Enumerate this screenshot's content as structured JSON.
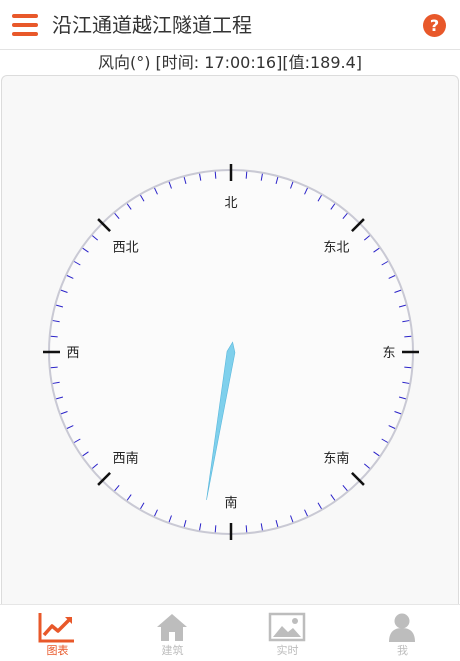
{
  "app": {
    "title": "沿江通道越江隧道工程",
    "menu_icon": "hamburger-menu-icon",
    "help_icon": "question-circle-icon",
    "help_glyph": "?",
    "accent_color": "#e8582a"
  },
  "chart_title": "风向(°) [时间: 17:00:16][值:189.4]",
  "chart_data": {
    "type": "gauge",
    "title": "风向(°) [时间: 17:00:16][值:189.4]",
    "metric": "风向(°)",
    "time": "17:00:16",
    "value": 189.4,
    "range": [
      0,
      360
    ],
    "direction_labels": [
      "北",
      "东北",
      "东",
      "东南",
      "南",
      "西南",
      "西",
      "西北"
    ],
    "major_tick_count": 8,
    "minor_tick_count": 72,
    "colors": {
      "needle": "#7fd0ec",
      "needle_edge": "#5bb8dc",
      "minor_tick": "#2a22c8",
      "major_tick": "#111111",
      "dial_rim": "#c9c9d4",
      "dial_face": "#fbfbfb"
    }
  },
  "nav": {
    "active_color": "#e8582a",
    "inactive_color": "#bdbdbd",
    "items": [
      {
        "label": "图表",
        "icon": "line-chart-icon",
        "active": true
      },
      {
        "label": "建筑",
        "icon": "home-icon",
        "active": false
      },
      {
        "label": "实时",
        "icon": "image-icon",
        "active": false
      },
      {
        "label": "我",
        "icon": "user-icon",
        "active": false
      }
    ]
  }
}
